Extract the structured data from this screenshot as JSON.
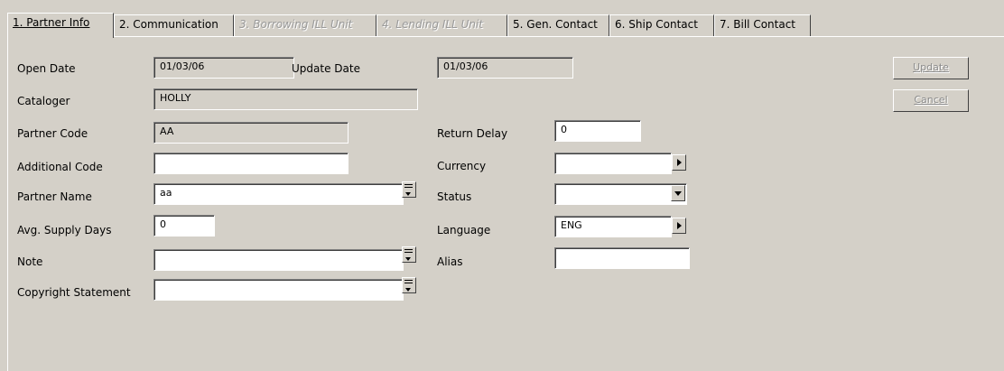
{
  "tabs": [
    {
      "label": "1. Partner Info",
      "state": "active"
    },
    {
      "label": "2. Communication",
      "state": "normal"
    },
    {
      "label": "3. Borrowing ILL Unit",
      "state": "disabled"
    },
    {
      "label": "4. Lending ILL Unit",
      "state": "disabled"
    },
    {
      "label": "5. Gen. Contact",
      "state": "normal"
    },
    {
      "label": "6. Ship Contact",
      "state": "normal"
    },
    {
      "label": "7. Bill Contact",
      "state": "normal"
    }
  ],
  "form": {
    "open_date": {
      "label": "Open Date",
      "value": "01/03/06"
    },
    "update_date": {
      "label": "Update Date",
      "value": "01/03/06"
    },
    "cataloger": {
      "label": "Cataloger",
      "value": "HOLLY"
    },
    "partner_code": {
      "label": "Partner Code",
      "value": "AA"
    },
    "additional_code": {
      "label": "Additional Code",
      "value": ""
    },
    "partner_name": {
      "label": "Partner Name",
      "value": "aa"
    },
    "avg_supply_days": {
      "label": "Avg. Supply Days",
      "value": "0"
    },
    "note": {
      "label": "Note",
      "value": ""
    },
    "copyright_statement": {
      "label": "Copyright Statement",
      "value": ""
    },
    "return_delay": {
      "label": "Return Delay",
      "value": "0"
    },
    "currency": {
      "label": "Currency",
      "value": ""
    },
    "status": {
      "label": "Status",
      "value": ""
    },
    "language": {
      "label": "Language",
      "value": "ENG"
    },
    "alias": {
      "label": "Alias",
      "value": ""
    }
  },
  "buttons": {
    "update": "Update",
    "cancel": "Cancel"
  },
  "colors": {
    "background": "#d4d0c8",
    "disabled_text": "#8a8a8a",
    "field_bg": "#ffffff"
  }
}
